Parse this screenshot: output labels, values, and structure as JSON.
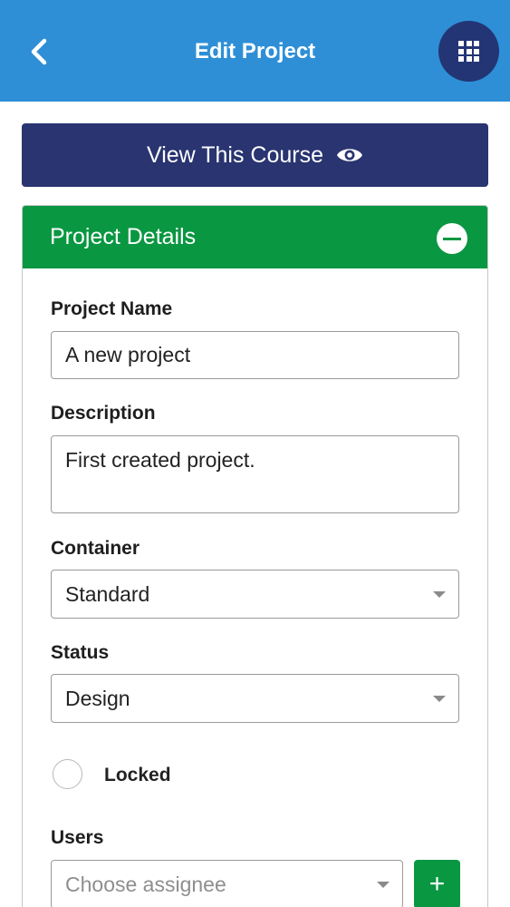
{
  "header": {
    "title": "Edit Project",
    "back_icon": "chevron-left-icon",
    "apps_icon": "grid-apps-icon",
    "background": "#2e8fd6",
    "apps_button_color": "#233574"
  },
  "view_course": {
    "label": "View This Course",
    "icon": "eye-icon",
    "background": "#293470"
  },
  "panel": {
    "title": "Project Details",
    "collapse_icon": "minus-circle-icon",
    "header_color": "#099741"
  },
  "form": {
    "project_name": {
      "label": "Project Name",
      "value": "A new project"
    },
    "description": {
      "label": "Description",
      "value": "First created project."
    },
    "container": {
      "label": "Container",
      "value": "Standard"
    },
    "status": {
      "label": "Status",
      "value": "Design"
    },
    "locked": {
      "label": "Locked",
      "checked": false
    },
    "users": {
      "label": "Users",
      "placeholder": "Choose assignee",
      "add_label": "+"
    }
  }
}
